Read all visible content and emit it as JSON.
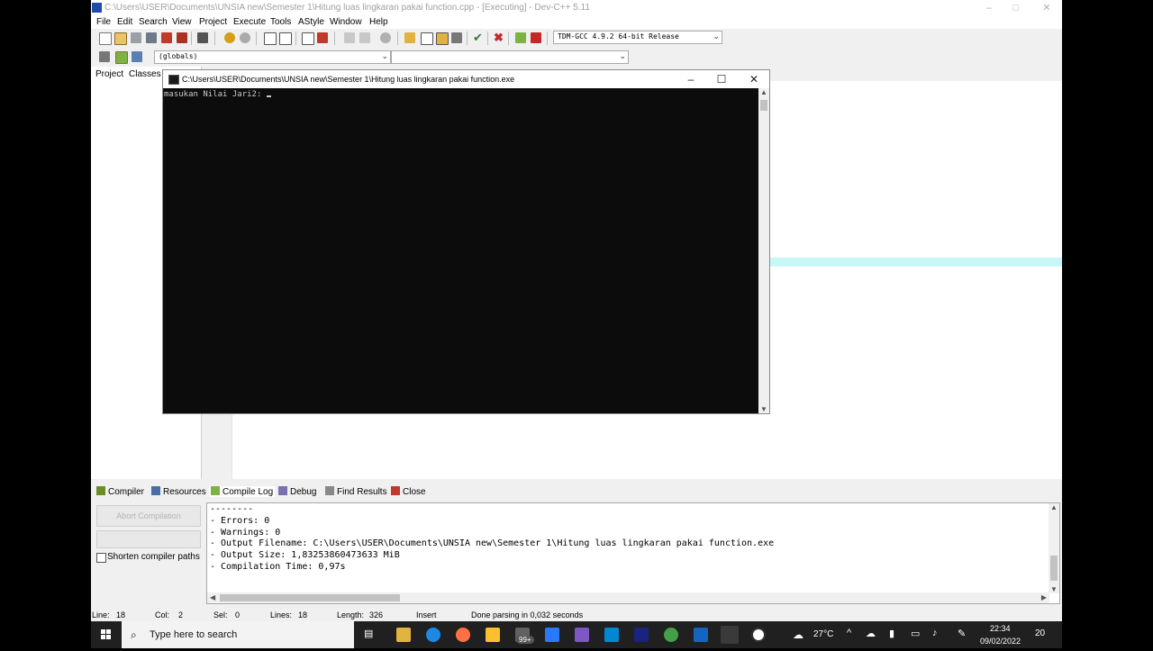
{
  "window": {
    "title": "C:\\Users\\USER\\Documents\\UNSIA new\\Semester 1\\Hitung luas lingkaran pakai function.cpp - [Executing] - Dev-C++ 5.11",
    "controls": {
      "minimize": "–",
      "maximize": "□",
      "close": "✕"
    }
  },
  "menu": [
    "File",
    "Edit",
    "Search",
    "View",
    "Project",
    "Execute",
    "Tools",
    "AStyle",
    "Window",
    "Help"
  ],
  "toolbar": {
    "compiler_select": "TDM-GCC 4.9.2 64-bit Release",
    "scope_select": "(globals)",
    "function_select": ""
  },
  "left_panel": {
    "tabs": [
      "Project",
      "Classes"
    ]
  },
  "console": {
    "title": "C:\\Users\\USER\\Documents\\UNSIA new\\Semester 1\\Hitung luas lingkaran pakai function.exe",
    "output": "masukan Nilai Jari2: ",
    "controls": {
      "minimize": "–",
      "maximize": "☐",
      "close": "✕"
    }
  },
  "bottom_tabs": [
    "Compiler",
    "Resources",
    "Compile Log",
    "Debug",
    "Find Results",
    "Close"
  ],
  "bottom_panel": {
    "abort_label": "Abort Compilation",
    "shorten_label": "Shorten compiler paths",
    "shorten_checked": false,
    "log_text": "--------\n- Errors: 0\n- Warnings: 0\n- Output Filename: C:\\Users\\USER\\Documents\\UNSIA new\\Semester 1\\Hitung luas lingkaran pakai function.exe\n- Output Size: 1,83253860473633 MiB\n- Compilation Time: 0,97s"
  },
  "status_bar": {
    "line_label": "Line:",
    "line_value": "18",
    "col_label": "Col:",
    "col_value": "2",
    "sel_label": "Sel:",
    "sel_value": "0",
    "lines_label": "Lines:",
    "lines_value": "18",
    "length_label": "Length:",
    "length_value": "326",
    "mode": "Insert",
    "message": "Done parsing in 0,032 seconds"
  },
  "taskbar": {
    "search_placeholder": "Type here to search",
    "badge": "99+",
    "temperature": "27°C",
    "time": "22:34",
    "date": "09/02/2022",
    "notifications": "20"
  },
  "colors": {
    "console_bg": "#0c0c0c",
    "console_text": "#cccccc",
    "highlight_line": "#c8f7f8",
    "taskbar_bg": "#202020"
  }
}
